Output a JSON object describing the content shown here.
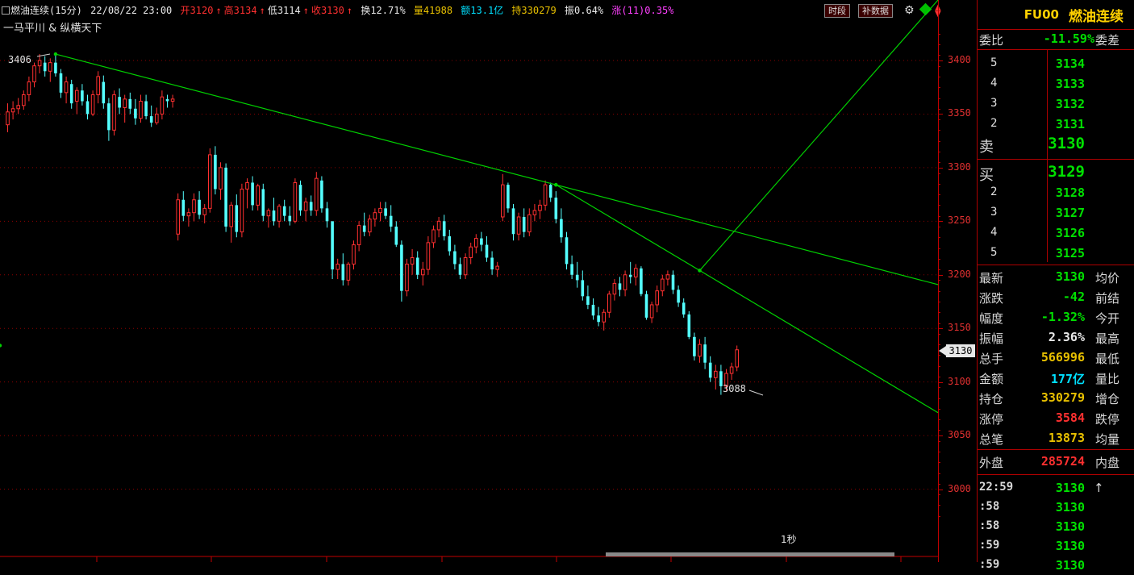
{
  "header": {
    "name_period": "燃油连续(15分)",
    "datetime": "22/08/22 23:00",
    "open": "开3120",
    "high": "高3134",
    "low": "低3114",
    "close": "收3130",
    "turnover": "换12.71%",
    "volume": "量41988",
    "amount": "额13.1亿",
    "open_interest": "持330279",
    "amplitude": "振0.64%",
    "change": "涨(11)0.35%",
    "btn_timeshare": "时段",
    "btn_supplement": "补数据"
  },
  "subtitle": "一马平川 & 纵横天下",
  "annotations": {
    "high_label": "3406",
    "low_label": "3088",
    "timer": "1秒"
  },
  "axis": {
    "labels": [
      "3400",
      "3350",
      "3300",
      "3250",
      "3200",
      "3150",
      "3100",
      "3050",
      "3000"
    ],
    "current": "3130"
  },
  "colors": {
    "up": "#ff3030",
    "down": "#54ffff",
    "trend": "#00d000",
    "grid": "#8b0000",
    "axis": "#c00000"
  },
  "chart_data": {
    "type": "candlestick",
    "title": "燃油连续(15分)",
    "ylim": [
      2975,
      3425
    ],
    "candles": [
      [
        3340,
        3360,
        3333,
        3352
      ],
      [
        3352,
        3362,
        3345,
        3355
      ],
      [
        3355,
        3365,
        3350,
        3358
      ],
      [
        3358,
        3372,
        3354,
        3368
      ],
      [
        3368,
        3385,
        3362,
        3380
      ],
      [
        3380,
        3398,
        3375,
        3395
      ],
      [
        3395,
        3406,
        3388,
        3400
      ],
      [
        3398,
        3404,
        3385,
        3390
      ],
      [
        3390,
        3402,
        3380,
        3398
      ],
      [
        3398,
        3406,
        3385,
        3388
      ],
      [
        3388,
        3392,
        3365,
        3370
      ],
      [
        3370,
        3385,
        3360,
        3380
      ],
      [
        3378,
        3382,
        3355,
        3360
      ],
      [
        3362,
        3375,
        3350,
        3372
      ],
      [
        3372,
        3378,
        3358,
        3362
      ],
      [
        3362,
        3368,
        3345,
        3350
      ],
      [
        3350,
        3372,
        3348,
        3368
      ],
      [
        3368,
        3390,
        3360,
        3385
      ],
      [
        3380,
        3386,
        3355,
        3360
      ],
      [
        3360,
        3365,
        3325,
        3335
      ],
      [
        3335,
        3372,
        3330,
        3368
      ],
      [
        3366,
        3374,
        3350,
        3356
      ],
      [
        3356,
        3368,
        3342,
        3364
      ],
      [
        3364,
        3370,
        3350,
        3355
      ],
      [
        3355,
        3364,
        3340,
        3346
      ],
      [
        3346,
        3368,
        3342,
        3362
      ],
      [
        3362,
        3368,
        3345,
        3348
      ],
      [
        3348,
        3358,
        3338,
        3342
      ],
      [
        3342,
        3356,
        3340,
        3350
      ],
      [
        3350,
        3372,
        3345,
        3366
      ],
      [
        3364,
        3368,
        3356,
        3362
      ],
      [
        3362,
        3368,
        3356,
        3364
      ],
      [
        3238,
        3276,
        3232,
        3270
      ],
      [
        3270,
        3278,
        3250,
        3255
      ],
      [
        3255,
        3262,
        3245,
        3258
      ],
      [
        3258,
        3276,
        3250,
        3270
      ],
      [
        3270,
        3278,
        3252,
        3256
      ],
      [
        3256,
        3266,
        3248,
        3262
      ],
      [
        3262,
        3318,
        3258,
        3312
      ],
      [
        3312,
        3320,
        3275,
        3280
      ],
      [
        3280,
        3305,
        3270,
        3300
      ],
      [
        3300,
        3304,
        3240,
        3245
      ],
      [
        3245,
        3268,
        3230,
        3265
      ],
      [
        3265,
        3275,
        3235,
        3240
      ],
      [
        3240,
        3285,
        3235,
        3280
      ],
      [
        3280,
        3290,
        3262,
        3286
      ],
      [
        3286,
        3292,
        3260,
        3265
      ],
      [
        3265,
        3285,
        3260,
        3283
      ],
      [
        3280,
        3285,
        3250,
        3255
      ],
      [
        3255,
        3262,
        3244,
        3260
      ],
      [
        3260,
        3272,
        3246,
        3250
      ],
      [
        3250,
        3266,
        3244,
        3264
      ],
      [
        3264,
        3270,
        3250,
        3255
      ],
      [
        3255,
        3264,
        3246,
        3250
      ],
      [
        3250,
        3290,
        3248,
        3286
      ],
      [
        3284,
        3288,
        3255,
        3260
      ],
      [
        3260,
        3272,
        3250,
        3268
      ],
      [
        3268,
        3274,
        3255,
        3260
      ],
      [
        3260,
        3296,
        3255,
        3290
      ],
      [
        3288,
        3292,
        3258,
        3262
      ],
      [
        3262,
        3268,
        3244,
        3250
      ],
      [
        3250,
        3215,
        3196,
        3205
      ],
      [
        3205,
        3215,
        3196,
        3210
      ],
      [
        3210,
        3220,
        3190,
        3195
      ],
      [
        3195,
        3212,
        3190,
        3210
      ],
      [
        3210,
        3232,
        3205,
        3228
      ],
      [
        3228,
        3250,
        3222,
        3246
      ],
      [
        3246,
        3258,
        3236,
        3240
      ],
      [
        3240,
        3256,
        3236,
        3252
      ],
      [
        3252,
        3262,
        3245,
        3258
      ],
      [
        3258,
        3268,
        3250,
        3262
      ],
      [
        3262,
        3268,
        3252,
        3255
      ],
      [
        3255,
        3265,
        3240,
        3245
      ],
      [
        3245,
        3250,
        3226,
        3228
      ],
      [
        3228,
        3232,
        3175,
        3185
      ],
      [
        3185,
        3215,
        3180,
        3210
      ],
      [
        3210,
        3224,
        3200,
        3216
      ],
      [
        3216,
        3222,
        3196,
        3200
      ],
      [
        3200,
        3212,
        3190,
        3205
      ],
      [
        3205,
        3236,
        3200,
        3230
      ],
      [
        3230,
        3246,
        3225,
        3242
      ],
      [
        3242,
        3254,
        3235,
        3250
      ],
      [
        3250,
        3256,
        3232,
        3236
      ],
      [
        3236,
        3242,
        3218,
        3222
      ],
      [
        3222,
        3228,
        3205,
        3210
      ],
      [
        3210,
        3216,
        3196,
        3200
      ],
      [
        3200,
        3220,
        3196,
        3216
      ],
      [
        3216,
        3230,
        3210,
        3226
      ],
      [
        3226,
        3238,
        3220,
        3234
      ],
      [
        3234,
        3240,
        3222,
        3228
      ],
      [
        3228,
        3236,
        3212,
        3216
      ],
      [
        3216,
        3222,
        3200,
        3205
      ],
      [
        3205,
        3212,
        3198,
        3208
      ],
      [
        3254,
        3294,
        3250,
        3284
      ],
      [
        3284,
        3286,
        3258,
        3262
      ],
      [
        3262,
        3266,
        3232,
        3238
      ],
      [
        3238,
        3258,
        3232,
        3254
      ],
      [
        3254,
        3262,
        3235,
        3240
      ],
      [
        3240,
        3262,
        3236,
        3256
      ],
      [
        3256,
        3266,
        3250,
        3260
      ],
      [
        3260,
        3270,
        3252,
        3265
      ],
      [
        3265,
        3288,
        3260,
        3284
      ],
      [
        3284,
        3286,
        3268,
        3272
      ],
      [
        3272,
        3278,
        3248,
        3252
      ],
      [
        3252,
        3262,
        3230,
        3235
      ],
      [
        3235,
        3240,
        3205,
        3210
      ],
      [
        3210,
        3218,
        3196,
        3200
      ],
      [
        3200,
        3212,
        3188,
        3195
      ],
      [
        3195,
        3204,
        3176,
        3180
      ],
      [
        3180,
        3190,
        3168,
        3172
      ],
      [
        3172,
        3178,
        3158,
        3162
      ],
      [
        3162,
        3170,
        3152,
        3156
      ],
      [
        3156,
        3168,
        3148,
        3165
      ],
      [
        3165,
        3185,
        3160,
        3182
      ],
      [
        3182,
        3196,
        3176,
        3192
      ],
      [
        3192,
        3198,
        3180,
        3186
      ],
      [
        3186,
        3204,
        3180,
        3200
      ],
      [
        3200,
        3212,
        3192,
        3198
      ],
      [
        3198,
        3210,
        3190,
        3206
      ],
      [
        3206,
        3208,
        3180,
        3182
      ],
      [
        3182,
        3185,
        3158,
        3160
      ],
      [
        3160,
        3175,
        3155,
        3172
      ],
      [
        3172,
        3190,
        3165,
        3185
      ],
      [
        3185,
        3200,
        3180,
        3196
      ],
      [
        3196,
        3204,
        3190,
        3200
      ],
      [
        3200,
        3204,
        3182,
        3186
      ],
      [
        3186,
        3190,
        3170,
        3174
      ],
      [
        3174,
        3178,
        3160,
        3163
      ],
      [
        3163,
        3166,
        3140,
        3142
      ],
      [
        3142,
        3146,
        3120,
        3124
      ],
      [
        3124,
        3140,
        3118,
        3135
      ],
      [
        3135,
        3142,
        3112,
        3118
      ],
      [
        3118,
        3124,
        3100,
        3104
      ],
      [
        3104,
        3116,
        3093,
        3110
      ],
      [
        3110,
        3116,
        3088,
        3096
      ],
      [
        3096,
        3112,
        3092,
        3108
      ],
      [
        3108,
        3118,
        3102,
        3114
      ],
      [
        3114,
        3134,
        3110,
        3130
      ]
    ]
  }
}
